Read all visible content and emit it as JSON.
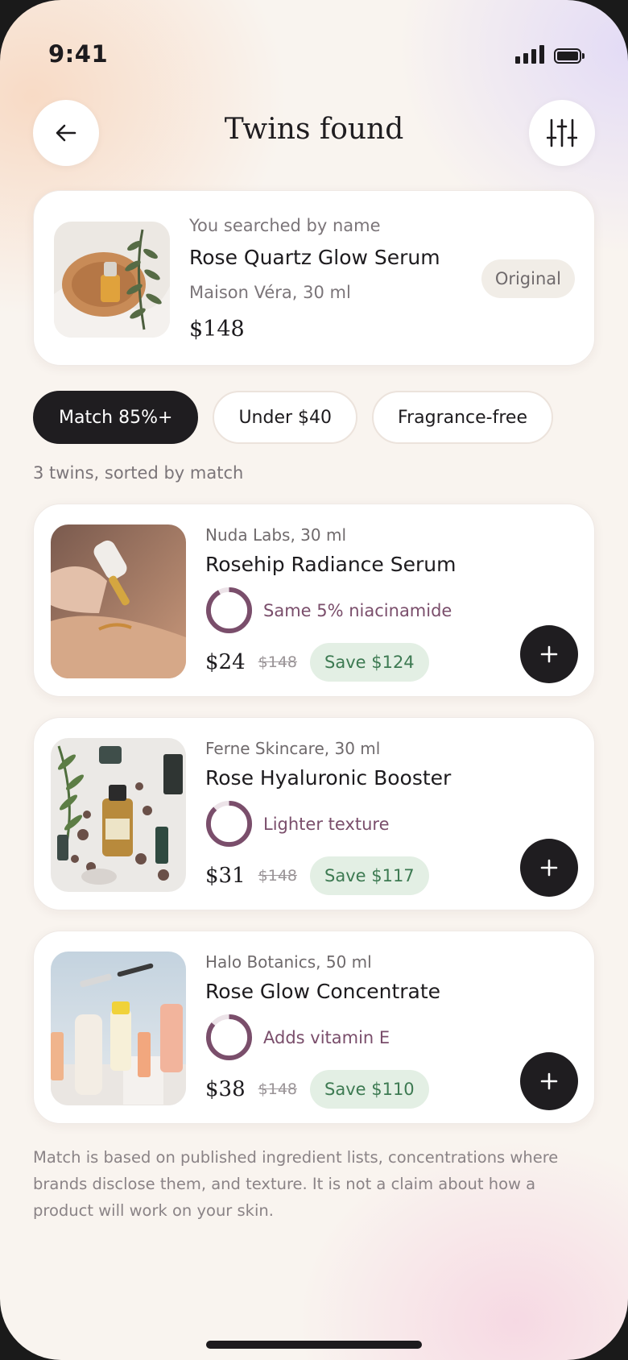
{
  "status_bar": {
    "time": "9:41"
  },
  "header": {
    "title": "Twins found",
    "back_icon": "arrow-left-icon",
    "filter_icon": "sliders-icon"
  },
  "original": {
    "label": "You searched by name",
    "name": "Rose Quartz Glow Serum",
    "brand": "Maison Véra, 30 ml",
    "price": "$148",
    "badge": "Original"
  },
  "filters": [
    {
      "label": "Match 85%+",
      "active": true
    },
    {
      "label": "Under $40",
      "active": false
    },
    {
      "label": "Fragrance-free",
      "active": false
    }
  ],
  "results_summary": "3 twins, sorted by match",
  "twins": [
    {
      "brand": "Nuda Labs, 30 ml",
      "name": "Rosehip Radiance Serum",
      "note": "Same 5% niacinamide",
      "price": "$24",
      "original_price": "$148",
      "save": "Save $124",
      "match_fraction": 0.92
    },
    {
      "brand": "Ferne Skincare, 30 ml",
      "name": "Rose Hyaluronic Booster",
      "note": "Lighter texture",
      "price": "$31",
      "original_price": "$148",
      "save": "Save $117",
      "match_fraction": 0.88
    },
    {
      "brand": "Halo Botanics, 50 ml",
      "name": "Rose Glow Concentrate",
      "note": "Adds vitamin E",
      "price": "$38",
      "original_price": "$148",
      "save": "Save $110",
      "match_fraction": 0.86
    }
  ],
  "disclaimer": "Match is based on published ingredient lists, concentrations where brands disclose them, and texture. It is not a claim about how a product will work on your skin.",
  "colors": {
    "accent": "#7a4e6b",
    "save_bg": "#e3efe4",
    "save_text": "#3d7a52",
    "dark": "#1f1d20"
  }
}
